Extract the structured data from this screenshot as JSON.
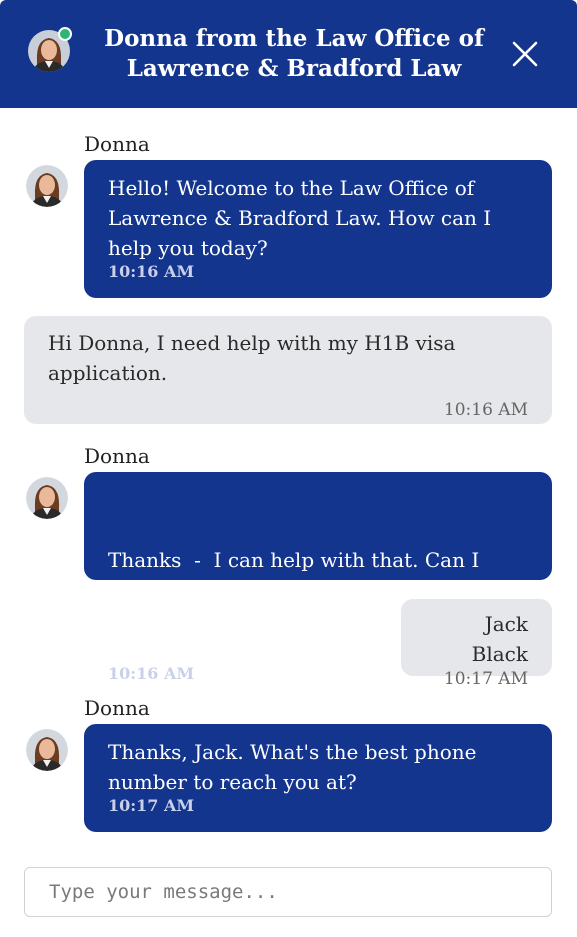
{
  "header": {
    "title_line1": "Donna from the Law Office of",
    "title_line2": "Lawrence & Bradford Law",
    "status_color": "#2bb673",
    "brand_color": "#14358e",
    "close_icon": "close-icon"
  },
  "messages": [
    {
      "sender": "agent",
      "name": "Donna",
      "text": "Hello! Welcome to the Law Office of Lawrence & Bradford Law. How can I help you today?",
      "time": "10:16 AM"
    },
    {
      "sender": "user",
      "text": "Hi Donna, I need help with my H1B visa application.",
      "time": "10:16 AM"
    },
    {
      "sender": "agent",
      "name": "Donna",
      "text": "Thanks  -  I can help with that. Can I please have your full name?",
      "time": "10:16 AM"
    },
    {
      "sender": "user",
      "text": "Jack Black",
      "time": "10:17 AM"
    },
    {
      "sender": "agent",
      "name": "Donna",
      "text": "Thanks, Jack. What's the best phone number to reach you at?",
      "time": "10:17 AM"
    }
  ],
  "composer": {
    "placeholder": "Type your message...",
    "value": ""
  }
}
